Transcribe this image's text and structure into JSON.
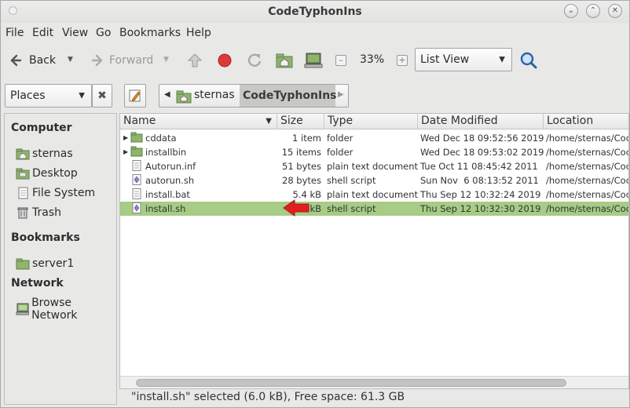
{
  "window": {
    "title": "CodeTyphonIns"
  },
  "menu": [
    "File",
    "Edit",
    "View",
    "Go",
    "Bookmarks",
    "Help"
  ],
  "toolbar": {
    "back": "Back",
    "forward": "Forward",
    "zoom": "33%",
    "view_mode": "List View"
  },
  "location": {
    "places_label": "Places",
    "crumbs": [
      "sternas",
      "CodeTyphonIns"
    ]
  },
  "sidebar": {
    "computer": {
      "heading": "Computer",
      "items": [
        "sternas",
        "Desktop",
        "File System",
        "Trash"
      ]
    },
    "bookmarks": {
      "heading": "Bookmarks",
      "items": [
        "server1"
      ]
    },
    "network": {
      "heading": "Network",
      "items": [
        "Browse Network"
      ]
    }
  },
  "columns": [
    "Name",
    "Size",
    "Type",
    "Date Modified",
    "Location"
  ],
  "files": [
    {
      "name": "cddata",
      "size": "1 item",
      "type": "folder",
      "modified": "Wed Dec 18 09:52:56 2019",
      "location": "/home/sternas/Coc",
      "kind": "folder",
      "selected": false
    },
    {
      "name": "installbin",
      "size": "15 items",
      "type": "folder",
      "modified": "Wed Dec 18 09:53:02 2019",
      "location": "/home/sternas/Coc",
      "kind": "folder",
      "selected": false
    },
    {
      "name": "Autorun.inf",
      "size": "51 bytes",
      "type": "plain text document",
      "modified": "Tue Oct 11 08:45:42 2011",
      "location": "/home/sternas/Coc",
      "kind": "text",
      "selected": false
    },
    {
      "name": "autorun.sh",
      "size": "28 bytes",
      "type": "shell script",
      "modified": "Sun Nov  6 08:13:52 2011",
      "location": "/home/sternas/Coc",
      "kind": "script",
      "selected": false
    },
    {
      "name": "install.bat",
      "size": "5.4 kB",
      "type": "plain text document",
      "modified": "Thu Sep 12 10:32:24 2019",
      "location": "/home/sternas/Coc",
      "kind": "text",
      "selected": false
    },
    {
      "name": "install.sh",
      "size": "6.0 kB",
      "type": "shell script",
      "modified": "Thu Sep 12 10:32:30 2019",
      "location": "/home/sternas/Coc",
      "kind": "script",
      "selected": true
    }
  ],
  "status": "\"install.sh\" selected (6.0 kB), Free space: 61.3 GB",
  "colors": {
    "selection": "#a6cc85",
    "arrow": "#e02020",
    "folder": "#7aa05a"
  }
}
